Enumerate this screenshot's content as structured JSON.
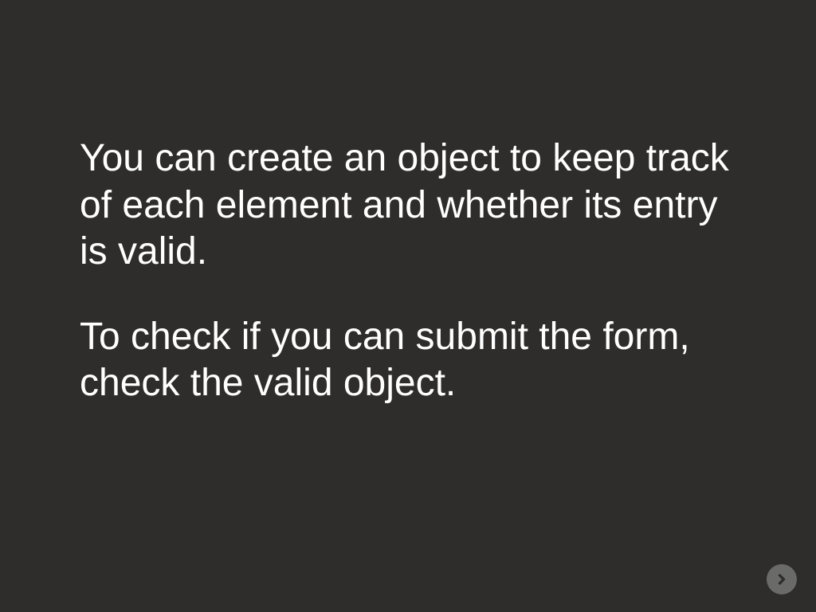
{
  "slide": {
    "paragraph1": "You can create an object to keep track of each element and whether its entry is valid.",
    "paragraph2": "To check if you can submit the form, check the valid object."
  },
  "colors": {
    "background": "#2e2d2b",
    "text": "#ffffff",
    "button_bg": "#6a6a68",
    "button_arrow": "#2e2d2b"
  }
}
